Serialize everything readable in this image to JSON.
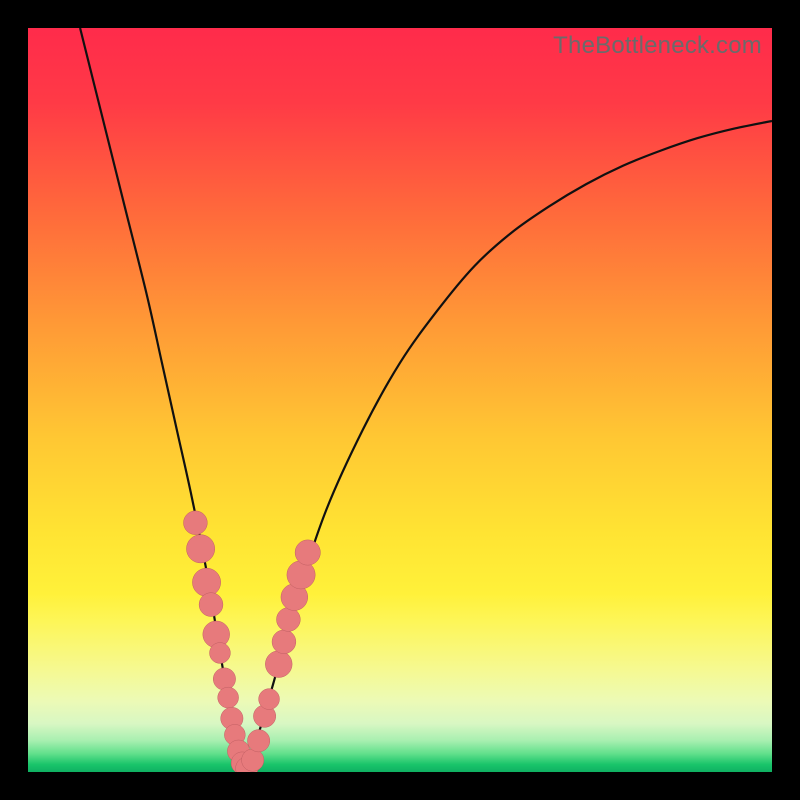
{
  "watermark": {
    "text": "TheBottleneck.com"
  },
  "colors": {
    "frame": "#000000",
    "gradient_stops": [
      {
        "offset": 0.0,
        "color": "#ff2b4b"
      },
      {
        "offset": 0.1,
        "color": "#ff3a46"
      },
      {
        "offset": 0.25,
        "color": "#ff6a3b"
      },
      {
        "offset": 0.4,
        "color": "#ff9a36"
      },
      {
        "offset": 0.55,
        "color": "#ffc733"
      },
      {
        "offset": 0.68,
        "color": "#ffe433"
      },
      {
        "offset": 0.76,
        "color": "#fff13a"
      },
      {
        "offset": 0.8,
        "color": "#fdf65a"
      },
      {
        "offset": 0.86,
        "color": "#f6f98f"
      },
      {
        "offset": 0.905,
        "color": "#ecfab6"
      },
      {
        "offset": 0.935,
        "color": "#d8f7c3"
      },
      {
        "offset": 0.958,
        "color": "#a7efb0"
      },
      {
        "offset": 0.975,
        "color": "#63e08c"
      },
      {
        "offset": 0.99,
        "color": "#19c46a"
      },
      {
        "offset": 1.0,
        "color": "#0fb062"
      }
    ],
    "curve_stroke": "#111111",
    "marker_fill": "#e77a7c",
    "marker_stroke": "#c15f63"
  },
  "chart_data": {
    "type": "line",
    "title": "",
    "xlabel": "",
    "ylabel": "",
    "xlim": [
      0,
      100
    ],
    "ylim": [
      0,
      100
    ],
    "grid": false,
    "series": [
      {
        "name": "bottleneck-curve",
        "x": [
          7,
          10,
          13,
          16,
          18,
          20,
          22,
          24,
          25.5,
          27,
          28,
          29,
          30,
          33,
          36,
          40,
          45,
          50,
          55,
          60,
          65,
          70,
          75,
          80,
          85,
          90,
          95,
          100
        ],
        "y": [
          100,
          88,
          76,
          64,
          55,
          46,
          37,
          27,
          18,
          9,
          3,
          0,
          2,
          12,
          23,
          35,
          46,
          55,
          62,
          68,
          72.5,
          76,
          79,
          81.5,
          83.5,
          85.2,
          86.5,
          87.5
        ]
      }
    ],
    "markers": [
      {
        "x": 22.5,
        "y": 33.5,
        "r": 1.6
      },
      {
        "x": 23.2,
        "y": 30.0,
        "r": 1.9
      },
      {
        "x": 24.0,
        "y": 25.5,
        "r": 1.9
      },
      {
        "x": 24.6,
        "y": 22.5,
        "r": 1.6
      },
      {
        "x": 25.3,
        "y": 18.5,
        "r": 1.8
      },
      {
        "x": 25.8,
        "y": 16.0,
        "r": 1.4
      },
      {
        "x": 26.4,
        "y": 12.5,
        "r": 1.5
      },
      {
        "x": 26.9,
        "y": 10.0,
        "r": 1.4
      },
      {
        "x": 27.4,
        "y": 7.2,
        "r": 1.5
      },
      {
        "x": 27.8,
        "y": 5.0,
        "r": 1.4
      },
      {
        "x": 28.3,
        "y": 2.8,
        "r": 1.5
      },
      {
        "x": 28.8,
        "y": 1.2,
        "r": 1.5
      },
      {
        "x": 29.4,
        "y": 0.5,
        "r": 1.5
      },
      {
        "x": 30.2,
        "y": 1.6,
        "r": 1.5
      },
      {
        "x": 31.0,
        "y": 4.2,
        "r": 1.5
      },
      {
        "x": 31.8,
        "y": 7.5,
        "r": 1.5
      },
      {
        "x": 32.4,
        "y": 9.8,
        "r": 1.4
      },
      {
        "x": 33.7,
        "y": 14.5,
        "r": 1.8
      },
      {
        "x": 34.4,
        "y": 17.5,
        "r": 1.6
      },
      {
        "x": 35.0,
        "y": 20.5,
        "r": 1.6
      },
      {
        "x": 35.8,
        "y": 23.5,
        "r": 1.8
      },
      {
        "x": 36.7,
        "y": 26.5,
        "r": 1.9
      },
      {
        "x": 37.6,
        "y": 29.5,
        "r": 1.7
      }
    ],
    "annotations": []
  }
}
